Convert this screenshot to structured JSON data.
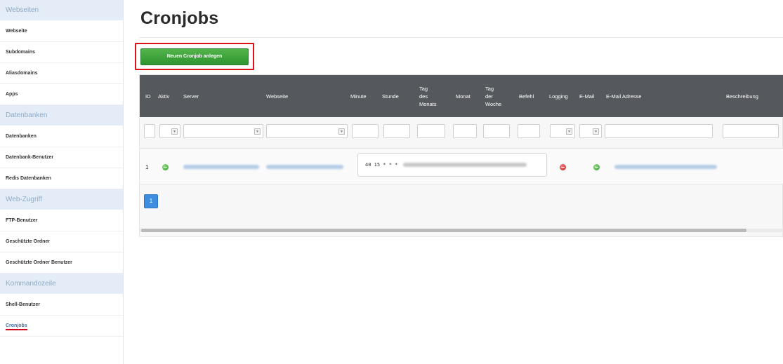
{
  "sidebar": {
    "sections": [
      {
        "title": "Webseiten",
        "items": [
          "Webseite",
          "Subdomains",
          "Aliasdomains",
          "Apps"
        ]
      },
      {
        "title": "Datenbanken",
        "items": [
          "Datenbanken",
          "Datenbank-Benutzer",
          "Redis Datenbanken"
        ]
      },
      {
        "title": "Web-Zugriff",
        "items": [
          "FTP-Benutzer",
          "Geschützte Ordner",
          "Geschützte Ordner Benutzer"
        ]
      },
      {
        "title": "Kommandozeile",
        "items": [
          "Shell-Benutzer",
          "Cronjobs"
        ]
      }
    ],
    "active_item": "Cronjobs"
  },
  "main": {
    "title": "Cronjobs",
    "new_button_label": "Neuen Cronjob anlegen"
  },
  "table": {
    "headers": {
      "id": "ID",
      "aktiv": "Aktiv",
      "server": "Server",
      "webseite": "Webseite",
      "minute": "Minute",
      "stunde": "Stunde",
      "tag_monat": [
        "Tag",
        "des",
        "Monats"
      ],
      "monat": "Monat",
      "tag_woche": [
        "Tag",
        "der",
        "Woche"
      ],
      "befehl": "Befehl",
      "logging": "Logging",
      "email": "E-Mail",
      "email_adresse": "E-Mail Adresse",
      "beschreibung": "Beschreibung"
    },
    "rows": [
      {
        "id": "1",
        "aktiv": "yes",
        "schedule": "40 15 * * *",
        "logging": "no",
        "email": "yes"
      }
    ],
    "filter_select_symbol": "▾"
  },
  "pagination": {
    "current_page": "1"
  },
  "colors": {
    "header_bg": "#55595d",
    "sidebar_section_bg": "#e4edf7",
    "button_green": "#3aa43a",
    "highlight_red": "#e0101a",
    "pager_blue": "#3d8ee0"
  },
  "icons": {
    "aktiv": "check-circle-icon",
    "logging": "cross-circle-icon",
    "email": "check-circle-icon",
    "select_arrow": "chevron-down-icon"
  }
}
